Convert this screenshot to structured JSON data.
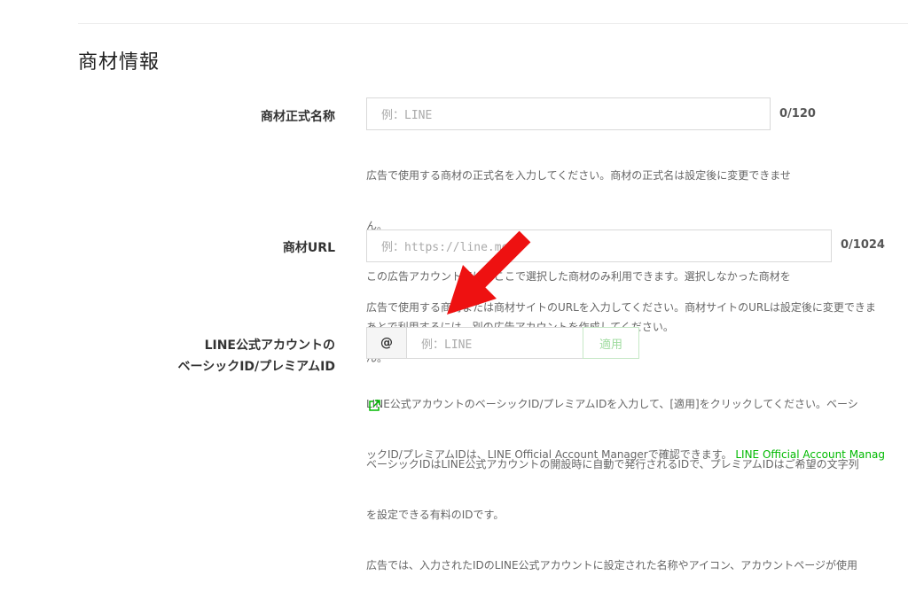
{
  "section": {
    "title": "商材情報"
  },
  "official_name": {
    "label": "商材正式名称",
    "placeholder": "例：LINE",
    "counter": "0/120",
    "help": [
      "広告で使用する商材の正式名を入力してください。商材の正式名は設定後に変更できませ",
      "ん。",
      "この広告アカウントでは、ここで選択した商材のみ利用できます。選択しなかった商材を",
      "あとで利用するには、別の広告アカウントを作成してください。"
    ]
  },
  "product_url": {
    "label": "商材URL",
    "placeholder": "例：https://line.me/",
    "counter": "0/1024",
    "help": [
      "広告で使用する商材または商材サイトのURLを入力してください。商材サイトのURLは設定後に変更できま",
      "ん。"
    ]
  },
  "line_id": {
    "label_line1": "LINE公式アカウントの",
    "label_line2": "ベーシックID/プレミアムID",
    "prefix": "@",
    "placeholder": "例：LINE",
    "apply_label": "適用",
    "help1_line1": "LINE公式アカウントのベーシックID/プレミアムIDを入力して、[適用]をクリックしてください。ベーシ",
    "help1_line2": "ックID/プレミアムIDは、LINE Official Account Managerで確認できます。",
    "help1_link": "LINE Official Account Manag",
    "help2": [
      "ベーシックIDはLINE公式アカウントの開設時に自動で発行されるIDで、プレミアムIDはご希望の文字列",
      "を設定できる有料のIDです。",
      "広告では、入力されたIDのLINE公式アカウントに設定された名称やアイコン、アカウントページが使用"
    ]
  },
  "colors": {
    "accent": "#00b900",
    "arrow": "#ee1111"
  },
  "icons": {
    "external_link": "external-link-icon",
    "annotation": "red-arrow"
  }
}
